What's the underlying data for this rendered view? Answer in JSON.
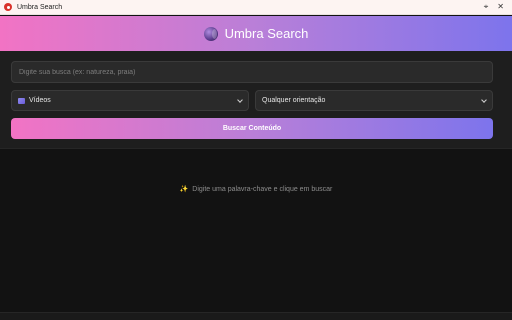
{
  "window": {
    "title": "Umbra Search",
    "pin_icon": "pin-icon",
    "close_icon": "close-icon"
  },
  "header": {
    "title": "Umbra Search",
    "logo_icon": "moon-icon"
  },
  "search": {
    "placeholder": "Digite sua busca (ex: natureza, praia)",
    "value": ""
  },
  "filters": {
    "type": {
      "selected": "Vídeos",
      "icon": "video-icon"
    },
    "orientation": {
      "selected": "Qualquer orientação"
    }
  },
  "actions": {
    "search_label": "Buscar Conteúdo"
  },
  "results": {
    "empty_icon": "sparkle-icon",
    "empty_text": "Digite uma palavra-chave e clique em buscar"
  },
  "colors": {
    "accent_start": "#f273c4",
    "accent_mid": "#b97fd8",
    "accent_end": "#7d74ec",
    "background": "#121212",
    "panel": "#1e1e1e"
  }
}
